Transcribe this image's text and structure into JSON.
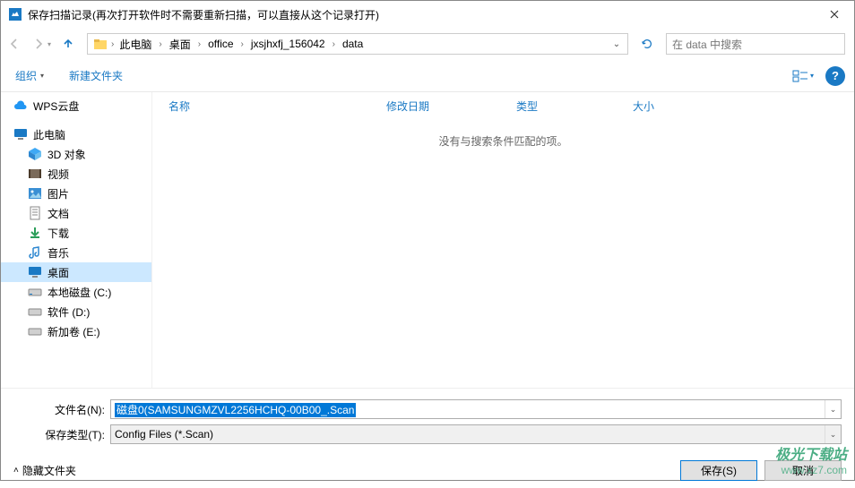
{
  "title": "保存扫描记录(再次打开软件时不需要重新扫描，可以直接从这个记录打开)",
  "nav": {
    "breadcrumbs": [
      "此电脑",
      "桌面",
      "office",
      "jxsjhxfj_156042",
      "data"
    ],
    "search_placeholder": "在 data 中搜索"
  },
  "toolbar": {
    "organize": "组织",
    "newfolder": "新建文件夹"
  },
  "sidebar": {
    "wps": "WPS云盘",
    "thispc": "此电脑",
    "children": [
      {
        "label": "3D 对象"
      },
      {
        "label": "视频"
      },
      {
        "label": "图片"
      },
      {
        "label": "文档"
      },
      {
        "label": "下载"
      },
      {
        "label": "音乐"
      },
      {
        "label": "桌面"
      },
      {
        "label": "本地磁盘 (C:)"
      },
      {
        "label": "软件 (D:)"
      },
      {
        "label": "新加卷 (E:)"
      }
    ]
  },
  "columns": {
    "name": "名称",
    "date": "修改日期",
    "type": "类型",
    "size": "大小"
  },
  "empty": "没有与搜索条件匹配的项。",
  "form": {
    "filename_label": "文件名(N):",
    "filename_value": "磁盘0(SAMSUNGMZVL2256HCHQ-00B00_.Scan",
    "type_label": "保存类型(T):",
    "type_value": "Config Files (*.Scan)"
  },
  "actions": {
    "hide": "隐藏文件夹",
    "save": "保存(S)",
    "cancel": "取消"
  },
  "help": "?",
  "watermark": {
    "line1": "极光下载站",
    "line2": "www.xz7.com"
  }
}
